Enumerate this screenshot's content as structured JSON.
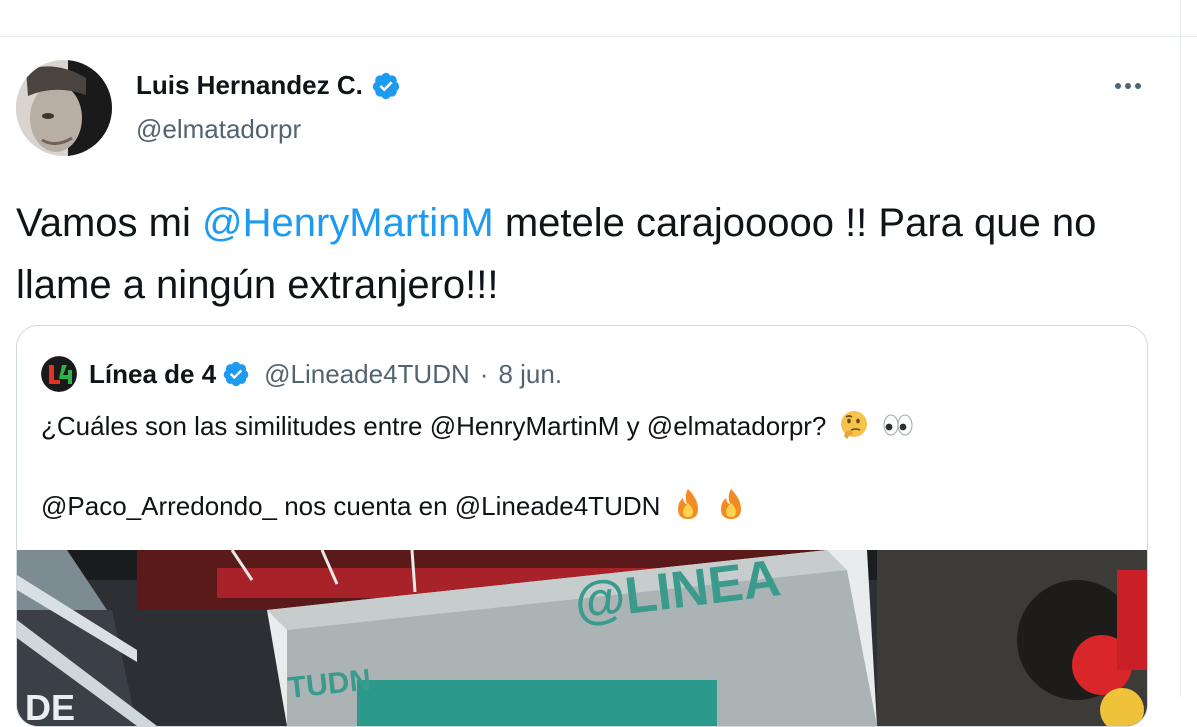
{
  "tweet": {
    "display_name": "Luis Hernandez C.",
    "handle": "@elmatadorpr",
    "text_parts": {
      "before": "Vamos mi ",
      "mention": "@HenryMartinM",
      "after": " metele carajooooo !! Para que no llame a ningún extranjero!!!"
    }
  },
  "quote": {
    "display_name": "Línea de 4",
    "handle": "@Lineade4TUDN",
    "separator": "·",
    "date": "8 jun.",
    "line1": "¿Cuáles son las similitudes entre @HenryMartinM y @elmatadorpr?",
    "line2": "@Paco_Arredondo_ nos cuenta en @Lineade4TUDN",
    "media_text_big": "@LINEA",
    "media_text_small": "TUDN",
    "media_text_left": "DE"
  },
  "icons": {
    "verified": "verified-badge-icon",
    "more": "more-dots-icon",
    "thinking": "thinking-face-emoji",
    "eyes": "eyes-emoji",
    "fire": "fire-emoji"
  },
  "colors": {
    "accent": "#1d9bf0",
    "secondary_text": "#536471",
    "border": "#cfd9de"
  }
}
